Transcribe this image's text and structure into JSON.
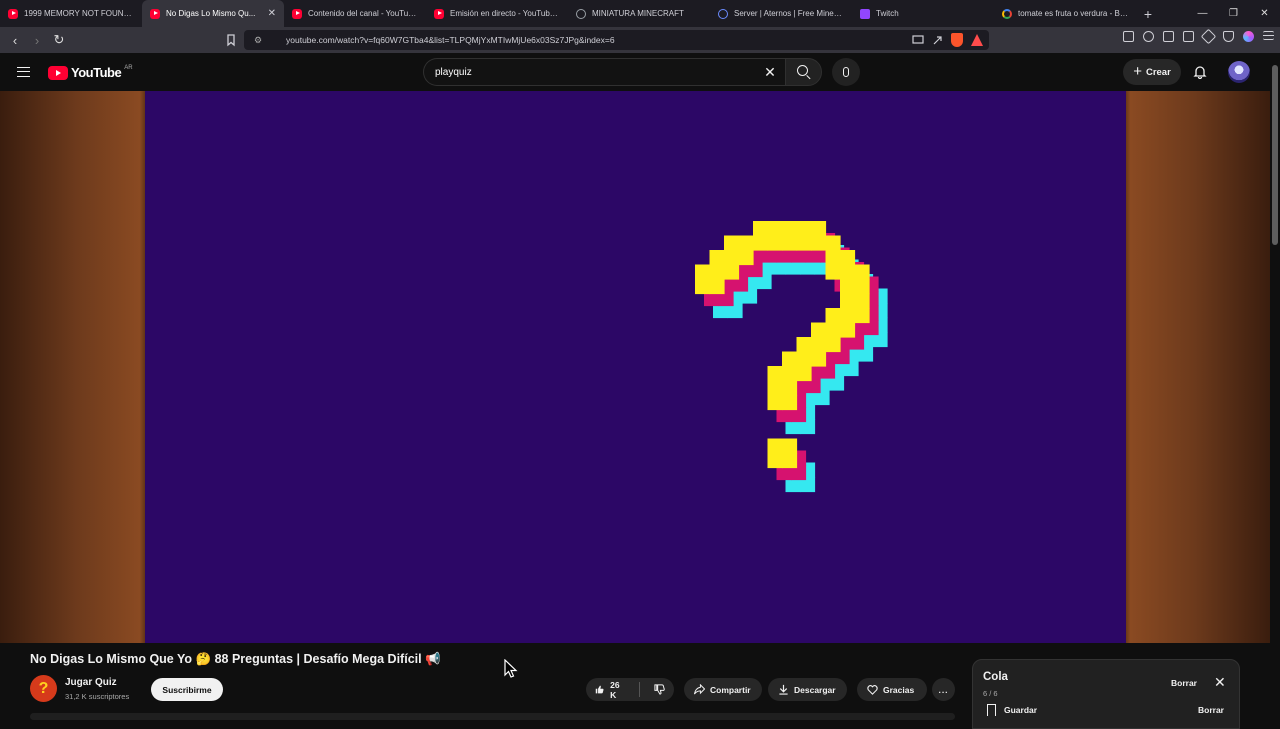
{
  "browser": {
    "tabs": [
      {
        "title": "1999 MEMORY NOT FOUND /...",
        "icon": "youtube-icon"
      },
      {
        "title": "No Digas Lo Mismo Qu...",
        "icon": "youtube-icon",
        "active": true
      },
      {
        "title": "Contenido del canal - YouTube...",
        "icon": "youtube-icon"
      },
      {
        "title": "Emisión en directo - YouTube S...",
        "icon": "youtube-icon"
      },
      {
        "title": "MINIATURA MINECRAFT",
        "icon": "globe-icon"
      },
      {
        "title": "Server | Aternos | Free Minecraf...",
        "icon": "aternos-icon"
      },
      {
        "title": "Twitch",
        "icon": "twitch-icon"
      },
      {
        "title": "tomate es fruta o verdura - Bu...",
        "icon": "google-icon"
      }
    ],
    "url": "youtube.com/watch?v=fq60W7GTba4&list=TLPQMjYxMTIwMjUe6x03Sz7JPg&index=6"
  },
  "youtube": {
    "logo_text": "YouTube",
    "country_code": "AR",
    "search_value": "playquiz",
    "create_label": "Crear"
  },
  "video": {
    "title": "No Digas Lo Mismo Que Yo 🤔 88 Preguntas | Desafío Mega Difícil 📢",
    "thumbnail_symbol": "?",
    "colors": {
      "background": "#2c0766",
      "yellow": "#ffee1a",
      "magenta": "#d6126f",
      "cyan": "#35e8f0"
    }
  },
  "channel": {
    "name": "Jugar Quiz",
    "subscribers": "31,2 K suscriptores",
    "subscribe_label": "Suscribirme"
  },
  "actions": {
    "likes": "26 K",
    "share": "Compartir",
    "download": "Descargar",
    "thanks": "Gracias",
    "more": "..."
  },
  "queue": {
    "title": "Cola",
    "count": "6 / 6",
    "clear_label": "Borrar",
    "save_label": "Guardar",
    "clear_label_2": "Borrar"
  }
}
